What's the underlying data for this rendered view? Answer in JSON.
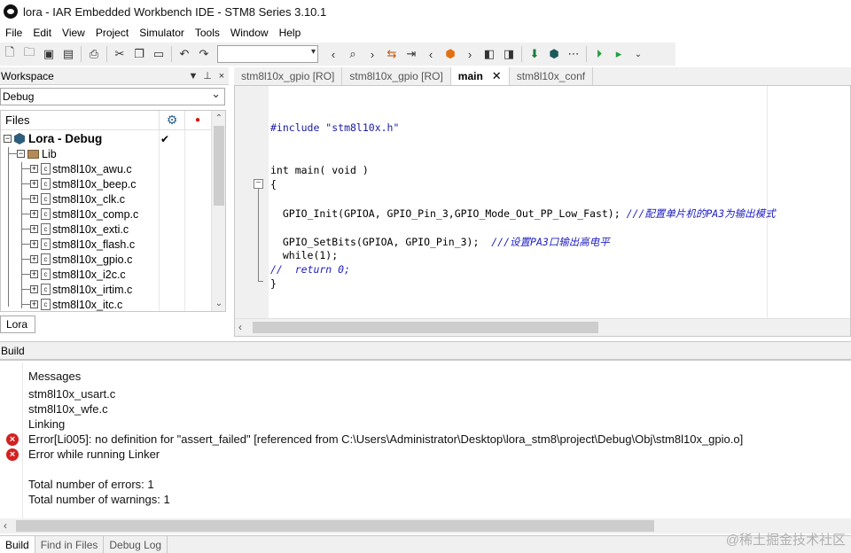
{
  "window": {
    "title": "lora - IAR Embedded Workbench IDE - STM8 Series 3.10.1"
  },
  "menu": [
    "File",
    "Edit",
    "View",
    "Project",
    "Simulator",
    "Tools",
    "Window",
    "Help"
  ],
  "workspace": {
    "title": "Workspace",
    "config": "Debug",
    "files_header": "Files",
    "project": "Lora - Debug",
    "folder": "Lib",
    "files": [
      "stm8l10x_awu.c",
      "stm8l10x_beep.c",
      "stm8l10x_clk.c",
      "stm8l10x_comp.c",
      "stm8l10x_exti.c",
      "stm8l10x_flash.c",
      "stm8l10x_gpio.c",
      "stm8l10x_i2c.c",
      "stm8l10x_irtim.c",
      "stm8l10x_itc.c"
    ],
    "tab": "Lora",
    "check": "✔"
  },
  "editor": {
    "tabs": [
      "stm8l10x_gpio [RO]",
      "stm8l10x_gpio [RO]",
      "main",
      "stm8l10x_conf"
    ],
    "active_tab": "main",
    "code": {
      "include": "#include \"stm8l10x.h\"",
      "main_sig": "int main( void )",
      "open_brace": "{",
      "gpio_init": "  GPIO_Init(GPIOA, GPIO_Pin_3,GPIO_Mode_Out_PP_Low_Fast); ",
      "gpio_init_comment": "///配置单片机的PA3为输出模式",
      "set_bits": "  GPIO_SetBits(GPIOA, GPIO_Pin_3);  ",
      "set_bits_comment": "///设置PA3口输出高电平",
      "while_line": "  while(1);",
      "return_comment": "//  return 0;",
      "close_brace": "}"
    }
  },
  "build": {
    "title": "Build",
    "header": "Messages",
    "lines": [
      "stm8l10x_usart.c",
      "stm8l10x_wfe.c",
      "Linking"
    ],
    "error1": "Error[Li005]: no definition for \"assert_failed\" [referenced from C:\\Users\\Administrator\\Desktop\\lora_stm8\\project\\Debug\\Obj\\stm8l10x_gpio.o]",
    "error2": "Error while running Linker",
    "summary_errors": "Total number of errors: 1",
    "summary_warnings": "Total number of warnings: 1"
  },
  "bottom_tabs": [
    "Build",
    "Find in Files",
    "Debug Log"
  ],
  "watermark": "@稀土掘金技术社区",
  "colors": {
    "comment": "#2020c0",
    "error": "#d42020",
    "run": "#1fa040"
  }
}
